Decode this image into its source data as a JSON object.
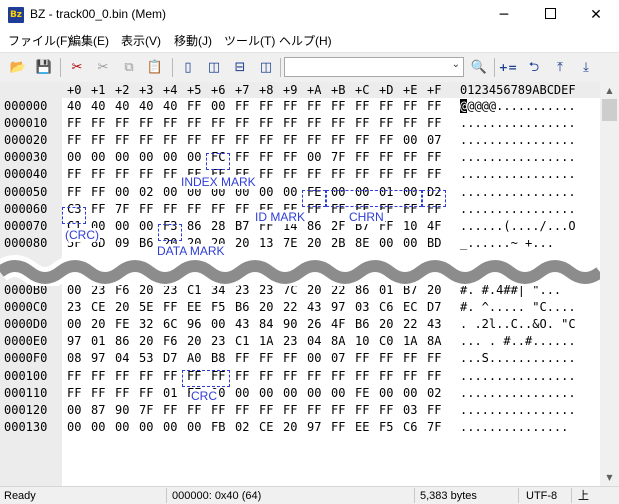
{
  "window": {
    "app_icon_label": "Bz",
    "title": "BZ - track00_0.bin (Mem)",
    "min_glyph": "─",
    "close_glyph": "✕"
  },
  "menu": [
    {
      "label": "ファイル(F)"
    },
    {
      "label": "編集(E)"
    },
    {
      "label": "表示(V)"
    },
    {
      "label": "移動(J)"
    },
    {
      "label": "ツール(T)"
    },
    {
      "label": "ヘルプ(H)"
    }
  ],
  "toolbar": {
    "open": "📂",
    "save": "💾",
    "cut_x": "✂",
    "cut": "✂",
    "copy": "⧉",
    "paste": "📋",
    "view1": "▯",
    "view2": "◫",
    "view3": "⊟",
    "view4": "◫",
    "search_value": "",
    "combo_arrow": "⌄",
    "find": "🔍",
    "addr_plus": "+=",
    "jump_back": "⮌",
    "jump_top": "⤒",
    "jump_down": "⤓"
  },
  "hex_header": [
    "+0",
    "+1",
    "+2",
    "+3",
    "+4",
    "+5",
    "+6",
    "+7",
    "+8",
    "+9",
    "+A",
    "+B",
    "+C",
    "+D",
    "+E",
    "+F"
  ],
  "ascii_header": "0123456789ABCDEF",
  "rows": [
    {
      "offset": "000000",
      "bytes": [
        "40",
        "40",
        "40",
        "40",
        "40",
        "FF",
        "00",
        "FF",
        "FF",
        "FF",
        "FF",
        "FF",
        "FF",
        "FF",
        "FF",
        "FF"
      ],
      "ascii": "@@@@@..........."
    },
    {
      "offset": "000010",
      "bytes": [
        "FF",
        "FF",
        "FF",
        "FF",
        "FF",
        "FF",
        "FF",
        "FF",
        "FF",
        "FF",
        "FF",
        "FF",
        "FF",
        "FF",
        "FF",
        "FF"
      ],
      "ascii": "................"
    },
    {
      "offset": "000020",
      "bytes": [
        "FF",
        "FF",
        "FF",
        "FF",
        "FF",
        "FF",
        "FF",
        "FF",
        "FF",
        "FF",
        "FF",
        "FF",
        "FF",
        "FF",
        "00",
        "07"
      ],
      "ascii": "................"
    },
    {
      "offset": "000030",
      "bytes": [
        "00",
        "00",
        "00",
        "00",
        "00",
        "00",
        "FC",
        "FF",
        "FF",
        "FF",
        "00",
        "7F",
        "FF",
        "FF",
        "FF",
        "FF"
      ],
      "ascii": "................"
    },
    {
      "offset": "000040",
      "bytes": [
        "FF",
        "FF",
        "FF",
        "FF",
        "FF",
        "FF",
        "FF",
        "FF",
        "FF",
        "FF",
        "FF",
        "FF",
        "FF",
        "FF",
        "FF",
        "FF"
      ],
      "ascii": "................"
    },
    {
      "offset": "000050",
      "bytes": [
        "FF",
        "FF",
        "00",
        "02",
        "00",
        "00",
        "00",
        "00",
        "00",
        "00",
        "FE",
        "00",
        "00",
        "01",
        "00",
        "D2"
      ],
      "ascii": "................"
    },
    {
      "offset": "000060",
      "bytes": [
        "C3",
        "FF",
        "7F",
        "FF",
        "FF",
        "FF",
        "FF",
        "FF",
        "FF",
        "FF",
        "FF",
        "FF",
        "FF",
        "FF",
        "FF",
        "FF"
      ],
      "ascii": "................"
    },
    {
      "offset": "000070",
      "bytes": [
        "C1",
        "00",
        "00",
        "00",
        "F3",
        "86",
        "28",
        "B7",
        "FF",
        "14",
        "86",
        "2F",
        "B7",
        "FF",
        "10",
        "4F"
      ],
      "ascii": "......(..../...O"
    },
    {
      "offset": "000080",
      "bytes": [
        "5F",
        "8D",
        "09",
        "B6",
        "20",
        "20",
        "20",
        "20",
        "13",
        "7E",
        "20",
        "2B",
        "8E",
        "00",
        "00",
        "BD"
      ],
      "ascii": "_......~ +..."
    },
    {
      "offset": "0000B0",
      "bytes": [
        "00",
        "23",
        "F6",
        "20",
        "23",
        "C1",
        "34",
        "23",
        "23",
        "7C",
        "20",
        "22",
        "86",
        "01",
        "B7",
        "20"
      ],
      "ascii": "#. #.4##| \"..."
    },
    {
      "offset": "0000C0",
      "bytes": [
        "23",
        "CE",
        "20",
        "5E",
        "FF",
        "EE",
        "F5",
        "B6",
        "20",
        "22",
        "43",
        "97",
        "03",
        "C6",
        "EC",
        "D7"
      ],
      "ascii": "#. ^..... \"C...."
    },
    {
      "offset": "0000D0",
      "bytes": [
        "00",
        "20",
        "FE",
        "32",
        "6C",
        "96",
        "00",
        "43",
        "84",
        "90",
        "26",
        "4F",
        "B6",
        "20",
        "22",
        "43"
      ],
      "ascii": ". .2l..C..&O. \"C"
    },
    {
      "offset": "0000E0",
      "bytes": [
        "97",
        "01",
        "86",
        "20",
        "F6",
        "20",
        "23",
        "C1",
        "1A",
        "23",
        "04",
        "8A",
        "10",
        "C0",
        "1A",
        "8A"
      ],
      "ascii": "... . #..#......"
    },
    {
      "offset": "0000F0",
      "bytes": [
        "08",
        "97",
        "04",
        "53",
        "D7",
        "A0",
        "B8",
        "FF",
        "FF",
        "FF",
        "00",
        "07",
        "FF",
        "FF",
        "FF",
        "FF"
      ],
      "ascii": "...S............"
    },
    {
      "offset": "000100",
      "bytes": [
        "FF",
        "FF",
        "FF",
        "FF",
        "FF",
        "FF",
        "FF",
        "FF",
        "FF",
        "FF",
        "FF",
        "FF",
        "FF",
        "FF",
        "FF",
        "FF"
      ],
      "ascii": "................"
    },
    {
      "offset": "000110",
      "bytes": [
        "FF",
        "FF",
        "FF",
        "FF",
        "01",
        "FE",
        "00",
        "00",
        "00",
        "00",
        "00",
        "00",
        "FE",
        "00",
        "00",
        "02"
      ],
      "ascii": "................"
    },
    {
      "offset": "000120",
      "bytes": [
        "00",
        "87",
        "90",
        "7F",
        "FF",
        "FF",
        "FF",
        "FF",
        "FF",
        "FF",
        "FF",
        "FF",
        "FF",
        "FF",
        "03",
        "FF"
      ],
      "ascii": "................"
    },
    {
      "offset": "000130",
      "bytes": [
        "00",
        "00",
        "00",
        "00",
        "00",
        "00",
        "FB",
        "02",
        "CE",
        "20",
        "97",
        "FF",
        "EE",
        "F5",
        "C6",
        "7F"
      ],
      "ascii": "............... "
    }
  ],
  "annotations": {
    "index_mark": "INDEX MARK",
    "id_mark": "ID MARK",
    "chrn": "CHRN",
    "crc1": "(CRC)",
    "data_mark": "DATA MARK",
    "crc2": "CRC"
  },
  "status": {
    "ready": "Ready",
    "position": "000000: 0x40 (64)",
    "size": "5,383 bytes",
    "encoding": "UTF-8",
    "extra": "上"
  },
  "scrollbar": {
    "up": "▲",
    "down": "▼"
  }
}
